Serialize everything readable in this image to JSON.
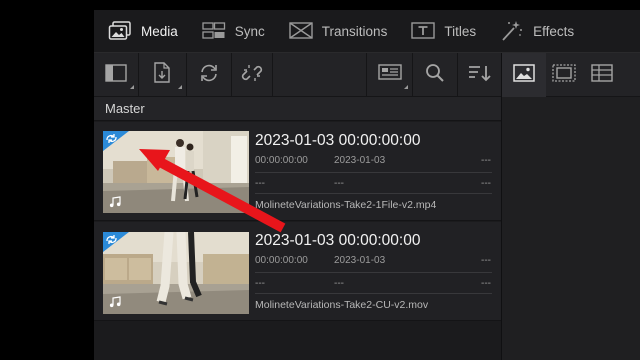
{
  "tabs": [
    {
      "label": "Media"
    },
    {
      "label": "Sync"
    },
    {
      "label": "Transitions"
    },
    {
      "label": "Titles"
    },
    {
      "label": "Effects"
    }
  ],
  "bin": {
    "label": "Master"
  },
  "clips": [
    {
      "title": "2023-01-03  00:00:00:00",
      "timecode": "00:00:00:00",
      "date": "2023-01-03",
      "dash": "---",
      "filename": "MolineteVariations-Take2-1File-v2.mp4"
    },
    {
      "title": "2023-01-03  00:00:00:00",
      "timecode": "00:00:00:00",
      "date": "2023-01-03",
      "dash": "---",
      "filename": "MolineteVariations-Take2-CU-v2.mov"
    }
  ],
  "colors": {
    "accent": "#2b8ad8",
    "annotation_arrow": "#e8151b"
  },
  "icons": [
    "media-icon",
    "sync-icon",
    "transitions-icon",
    "titles-icon",
    "effects-icon",
    "panel-toggle-icon",
    "import-icon",
    "relink-icon",
    "unlink-icon",
    "view-mode-icon",
    "search-icon",
    "sort-icon",
    "thumbnail-view-icon",
    "filmstrip-view-icon",
    "list-view-icon",
    "linked-clip-icon",
    "audio-note-icon"
  ]
}
